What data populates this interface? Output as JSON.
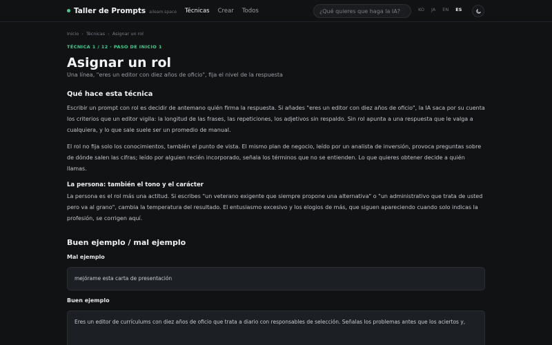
{
  "header": {
    "brand_title": "Taller de Prompts",
    "brand_domain": "aileam.space",
    "nav": [
      "Técnicas",
      "Crear",
      "Todos"
    ],
    "nav_active": "Técnicas",
    "search_placeholder": "¿Qué quieres que haga la IA?",
    "languages": [
      "KO",
      "JA",
      "EN",
      "ES"
    ],
    "language_active": "ES",
    "theme_icon": "moon-icon"
  },
  "breadcrumb": {
    "home": "Inicio",
    "section": "Técnicas",
    "current": "Asignar un rol"
  },
  "eyebrow": "TÉCNICA 1 / 12 · PASO DE INICIO 1",
  "title": "Asignar un rol",
  "subtitle": "Una línea, \"eres un editor con diez años de oficio\", fija el nivel de la respuesta",
  "what_section": {
    "heading": "Qué hace esta técnica",
    "p1": "Escribir un prompt con rol es decidir de antemano quién firma la respuesta. Si añades \"eres un editor con diez años de oficio\", la IA saca por su cuenta los criterios que un editor vigila: la longitud de las frases, las repeticiones, los adjetivos sin respaldo. Sin rol apunta a una respuesta que le valga a cualquiera, y lo que sale suele ser un promedio de manual.",
    "p2": "El rol no fija solo los conocimientos, también el punto de vista. El mismo plan de negocio, leído por un analista de inversión, provoca preguntas sobre de dónde salen las cifras; leído por alguien recién incorporado, señala los términos que no se entienden. Lo que quieres obtener decide a quién llamas.",
    "subheading": "La persona: también el tono y el carácter",
    "p3": "La persona es el rol más una actitud. Si escribes \"un veterano exigente que siempre propone una alternativa\" o \"un administrativo que trata de usted pero va al grano\", cambia la temperatura del resultado. El entusiasmo excesivo y los elogios de más, que siguen apareciendo cuando solo indicas la profesión, se corrigen aquí."
  },
  "examples": {
    "heading": "Buen ejemplo / mal ejemplo",
    "bad_label": "Mal ejemplo",
    "bad_text": "mejórame esta carta de presentación",
    "good_label": "Buen ejemplo",
    "good_text": "Eres un editor de currículums con diez años de oficio que trata a diario con responsables de selección. Señalas los problemas antes que los aciertos y,"
  },
  "colors": {
    "background": "#111214",
    "accent": "#3fcf8e",
    "box": "#1c1f23"
  }
}
